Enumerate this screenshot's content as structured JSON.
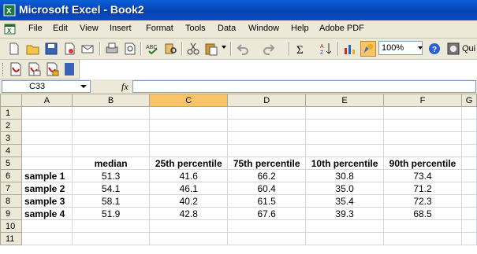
{
  "window": {
    "title": "Microsoft Excel - Book2"
  },
  "menu": [
    "File",
    "Edit",
    "View",
    "Insert",
    "Format",
    "Tools",
    "Data",
    "Window",
    "Help",
    "Adobe PDF"
  ],
  "toolbar": {
    "zoom": "100%",
    "quick_label": "Qui"
  },
  "formula_bar": {
    "cell_ref": "C33",
    "fx": "fx",
    "value": ""
  },
  "columns": [
    "",
    "A",
    "B",
    "C",
    "D",
    "E",
    "F",
    "G"
  ],
  "selected_column": "C",
  "rows": [
    {
      "num": "1",
      "cells": [
        "",
        "",
        "",
        "",
        "",
        "",
        ""
      ]
    },
    {
      "num": "2",
      "cells": [
        "",
        "",
        "",
        "",
        "",
        "",
        ""
      ]
    },
    {
      "num": "3",
      "cells": [
        "",
        "",
        "",
        "",
        "",
        "",
        ""
      ]
    },
    {
      "num": "4",
      "cells": [
        "",
        "",
        "",
        "",
        "",
        "",
        ""
      ]
    },
    {
      "num": "5",
      "cells": [
        "",
        "median",
        "25th percentile",
        "75th percentile",
        "10th percentile",
        "90th percentile",
        ""
      ]
    },
    {
      "num": "6",
      "cells": [
        "sample 1",
        "51.3",
        "41.6",
        "66.2",
        "30.8",
        "73.4",
        ""
      ]
    },
    {
      "num": "7",
      "cells": [
        "sample 2",
        "54.1",
        "46.1",
        "60.4",
        "35.0",
        "71.2",
        ""
      ]
    },
    {
      "num": "8",
      "cells": [
        "sample 3",
        "58.1",
        "40.2",
        "61.5",
        "35.4",
        "72.3",
        ""
      ]
    },
    {
      "num": "9",
      "cells": [
        "sample 4",
        "51.9",
        "42.8",
        "67.6",
        "39.3",
        "68.5",
        ""
      ]
    },
    {
      "num": "10",
      "cells": [
        "",
        "",
        "",
        "",
        "",
        "",
        ""
      ]
    },
    {
      "num": "11",
      "cells": [
        "",
        "",
        "",
        "",
        "",
        "",
        ""
      ]
    }
  ]
}
